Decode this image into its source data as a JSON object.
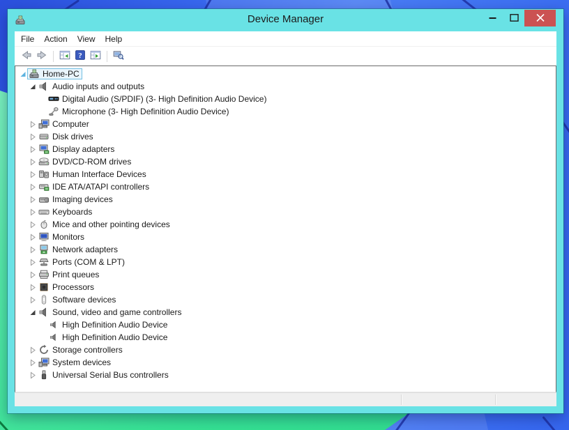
{
  "window": {
    "title": "Device Manager",
    "colors": {
      "titlebar": "#69e2e5",
      "close_button": "#cb5252",
      "selection_border": "#73bfe3",
      "wallpaper_blue": "#3a6cf0",
      "wallpaper_green": "#45e59d"
    }
  },
  "titlebar": {
    "buttons": [
      {
        "name": "minimize-button",
        "icon": "minimize-icon"
      },
      {
        "name": "maximize-button",
        "icon": "maximize-icon"
      },
      {
        "name": "close-button",
        "icon": "close-icon"
      }
    ]
  },
  "menu": {
    "items": [
      {
        "label": "File"
      },
      {
        "label": "Action"
      },
      {
        "label": "View"
      },
      {
        "label": "Help"
      }
    ]
  },
  "toolbar": {
    "buttons": [
      {
        "name": "back-button",
        "icon": "back-arrow-icon"
      },
      {
        "name": "forward-button",
        "icon": "forward-arrow-icon"
      },
      {
        "separator": true
      },
      {
        "name": "show-console-tree-button",
        "icon": "console-tree-icon"
      },
      {
        "name": "help-button",
        "icon": "help-icon"
      },
      {
        "name": "show-action-pane-button",
        "icon": "action-pane-icon"
      },
      {
        "separator": true
      },
      {
        "name": "scan-hardware-button",
        "icon": "scan-hardware-icon"
      }
    ]
  },
  "tree": {
    "rows": [
      {
        "label": "Home-PC",
        "depth": 0,
        "icon": "device-manager-icon",
        "expander": "open",
        "selected": true
      },
      {
        "label": "Audio inputs and outputs",
        "depth": 1,
        "icon": "speaker-icon",
        "expander": "open"
      },
      {
        "label": "Digital Audio (S/PDIF) (3- High Definition Audio Device)",
        "depth": 2,
        "icon": "digital-audio-icon"
      },
      {
        "label": "Microphone (3- High Definition Audio Device)",
        "depth": 2,
        "icon": "microphone-icon"
      },
      {
        "label": "Computer",
        "depth": 1,
        "icon": "computer-icon",
        "expander": "closed"
      },
      {
        "label": "Disk drives",
        "depth": 1,
        "icon": "disk-drive-icon",
        "expander": "closed"
      },
      {
        "label": "Display adapters",
        "depth": 1,
        "icon": "display-adapter-icon",
        "expander": "closed"
      },
      {
        "label": "DVD/CD-ROM drives",
        "depth": 1,
        "icon": "dvd-drive-icon",
        "expander": "closed"
      },
      {
        "label": "Human Interface Devices",
        "depth": 1,
        "icon": "hid-icon",
        "expander": "closed"
      },
      {
        "label": "IDE ATA/ATAPI controllers",
        "depth": 1,
        "icon": "ide-controller-icon",
        "expander": "closed"
      },
      {
        "label": "Imaging devices",
        "depth": 1,
        "icon": "imaging-device-icon",
        "expander": "closed"
      },
      {
        "label": "Keyboards",
        "depth": 1,
        "icon": "keyboard-icon",
        "expander": "closed"
      },
      {
        "label": "Mice and other pointing devices",
        "depth": 1,
        "icon": "mouse-icon",
        "expander": "closed"
      },
      {
        "label": "Monitors",
        "depth": 1,
        "icon": "monitor-icon",
        "expander": "closed"
      },
      {
        "label": "Network adapters",
        "depth": 1,
        "icon": "network-adapter-icon",
        "expander": "closed"
      },
      {
        "label": "Ports (COM & LPT)",
        "depth": 1,
        "icon": "ports-icon",
        "expander": "closed"
      },
      {
        "label": "Print queues",
        "depth": 1,
        "icon": "printer-icon",
        "expander": "closed"
      },
      {
        "label": "Processors",
        "depth": 1,
        "icon": "processor-icon",
        "expander": "closed"
      },
      {
        "label": "Software devices",
        "depth": 1,
        "icon": "software-device-icon",
        "expander": "closed"
      },
      {
        "label": "Sound, video and game controllers",
        "depth": 1,
        "icon": "speaker-icon",
        "expander": "open"
      },
      {
        "label": "High Definition Audio Device",
        "depth": 2,
        "icon": "hd-audio-icon"
      },
      {
        "label": "High Definition Audio Device",
        "depth": 2,
        "icon": "hd-audio-icon"
      },
      {
        "label": "Storage controllers",
        "depth": 1,
        "icon": "storage-controller-icon",
        "expander": "closed"
      },
      {
        "label": "System devices",
        "depth": 1,
        "icon": "system-device-icon",
        "expander": "closed"
      },
      {
        "label": "Universal Serial Bus controllers",
        "depth": 1,
        "icon": "usb-icon",
        "expander": "closed"
      }
    ]
  }
}
